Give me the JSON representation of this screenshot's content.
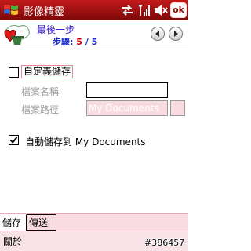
{
  "titlebar": {
    "title": "影像精靈",
    "ok_label": "ok",
    "icons": [
      "windows-start-icon",
      "sync-arrows-icon",
      "signal-strength-icon",
      "speaker-muted-icon"
    ]
  },
  "wizard": {
    "title": "最後一步",
    "step_label": "步驟:",
    "step_current": "5",
    "step_separator": "/",
    "step_total": "5"
  },
  "form": {
    "custom_save": {
      "label": "自定義儲存",
      "checked": false
    },
    "filename": {
      "label": "檔案名稱",
      "value": ""
    },
    "filepath": {
      "label": "檔案路徑",
      "value": "My Documents"
    },
    "auto_save": {
      "label": "自動儲存到 My Documents",
      "checked": true
    }
  },
  "tabs": [
    {
      "label": "儲存",
      "active": true
    },
    {
      "label": "傳送",
      "active": false
    }
  ],
  "menubar": {
    "left_label": "關於"
  },
  "watermark": "#386457",
  "colors": {
    "titlebar": "#a31010",
    "accent_pink": "#f9dce2",
    "step_blue": "#1f2fc8",
    "step_red": "#d00000"
  }
}
